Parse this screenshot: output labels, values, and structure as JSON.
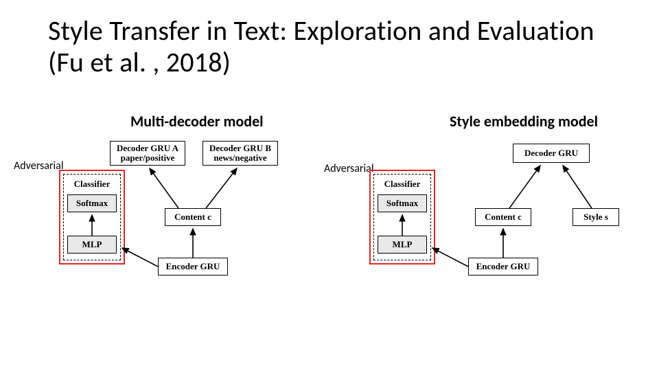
{
  "title": "Style Transfer in Text: Exploration and Evaluation (Fu et al. , 2018)",
  "subheads": {
    "left": "Multi-decoder model",
    "right": "Style embedding model"
  },
  "labels": {
    "adversarial": "Adversarial"
  },
  "diagram": {
    "shared": {
      "classifier": "Classifier",
      "softmax": "Softmax",
      "mlp": "MLP",
      "content": "Content c",
      "encoder": "Encoder GRU"
    },
    "left": {
      "decoderA_l1": "Decoder GRU A",
      "decoderA_l2": "paper/positive",
      "decoderB_l1": "Decoder GRU B",
      "decoderB_l2": "news/negative"
    },
    "right": {
      "decoder": "Decoder GRU",
      "style": "Style s"
    }
  },
  "chart_data": {
    "type": "diagram",
    "models": [
      {
        "name": "Multi-decoder model",
        "adversarial_branch": [
          "Classifier",
          "Softmax",
          "MLP"
        ],
        "encoder": "Encoder GRU",
        "latent": [
          "Content c"
        ],
        "decoders": [
          {
            "name": "Decoder GRU A",
            "tag": "paper/positive"
          },
          {
            "name": "Decoder GRU B",
            "tag": "news/negative"
          }
        ],
        "edges": [
          [
            "Encoder GRU",
            "Content c"
          ],
          [
            "Content c",
            "Decoder GRU A"
          ],
          [
            "Content c",
            "Decoder GRU B"
          ],
          [
            "Encoder GRU",
            "MLP"
          ],
          [
            "MLP",
            "Softmax"
          ],
          [
            "Softmax",
            "Classifier"
          ]
        ]
      },
      {
        "name": "Style embedding model",
        "adversarial_branch": [
          "Classifier",
          "Softmax",
          "MLP"
        ],
        "encoder": "Encoder GRU",
        "latent": [
          "Content c",
          "Style s"
        ],
        "decoders": [
          {
            "name": "Decoder GRU"
          }
        ],
        "edges": [
          [
            "Encoder GRU",
            "Content c"
          ],
          [
            "Content c",
            "Decoder GRU"
          ],
          [
            "Style s",
            "Decoder GRU"
          ],
          [
            "Encoder GRU",
            "MLP"
          ],
          [
            "MLP",
            "Softmax"
          ],
          [
            "Softmax",
            "Classifier"
          ]
        ]
      }
    ]
  }
}
